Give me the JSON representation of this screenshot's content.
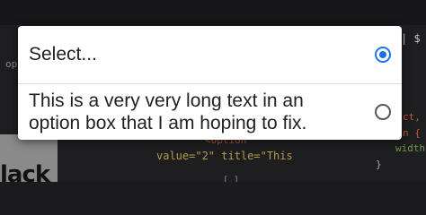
{
  "dialog": {
    "options": [
      {
        "label": "Select...",
        "selected": true
      },
      {
        "label": "This is a very very long text in an option box that I am hoping to fix.",
        "selected": false
      }
    ]
  },
  "background": {
    "left_snippet": "op",
    "left_panel_text": "lack",
    "code_lines": [
      "<option",
      "value=\"2\" title=\"This",
      "[ ]"
    ],
    "right_top": "| $",
    "right_lines": [
      "ct,",
      "n {",
      "width:",
      "}"
    ]
  },
  "colors": {
    "accent": "#1a73e8",
    "radio_unselected": "#555555"
  }
}
